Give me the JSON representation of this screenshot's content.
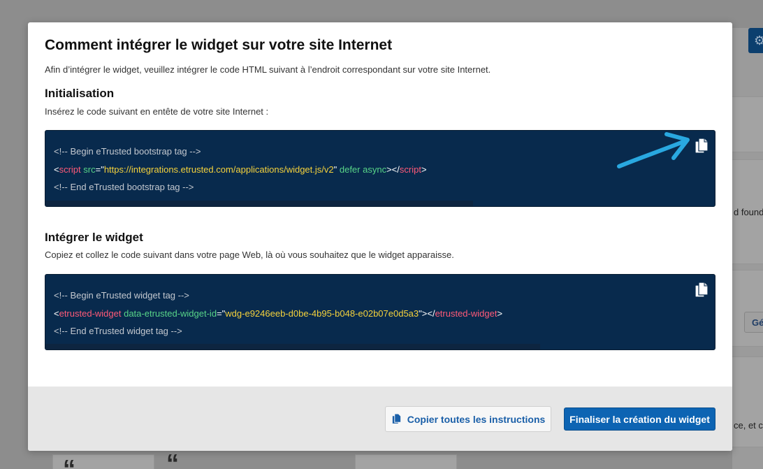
{
  "background": {
    "right_text_1": "d found",
    "right_text_2": "ce, et c",
    "right_button": "Gé",
    "quote_glyph": "“"
  },
  "modal": {
    "title": "Comment intégrer le widget sur votre site Internet",
    "intro": "Afin d’intégrer le widget, veuillez intégrer le code HTML suivant à l’endroit correspondant sur votre site Internet.",
    "sections": [
      {
        "title": "Initialisation",
        "description": "Insérez le code suivant en entête de votre site Internet :",
        "code": {
          "comment_begin": "<!-- Begin eTrusted bootstrap tag -->",
          "open_bracket": "<",
          "tag": "script",
          "attr_1": " src",
          "eq": "=",
          "quote": "\"",
          "value_1": "https://integrations.etrusted.com/applications/widget.js/v2",
          "attr_2": " defer async",
          "close_open": "></",
          "close_bracket": ">",
          "comment_end": "<!-- End eTrusted bootstrap tag -->"
        }
      },
      {
        "title": "Intégrer le widget",
        "description": "Copiez et collez le code suivant dans votre page Web, là où vous souhaitez que le widget apparaisse.",
        "code": {
          "comment_begin": "<!-- Begin eTrusted widget tag -->",
          "open_bracket": "<",
          "tag": "etrusted-widget",
          "attr_1": " data-etrusted-widget-id",
          "eq": "=",
          "quote": "\"",
          "value_1": "wdg-e9246eeb-d0be-4b95-b048-e02b07e0d5a3",
          "close_open": "></",
          "close_bracket": ">",
          "comment_end": "<!-- End eTrusted widget tag -->"
        }
      }
    ],
    "footer": {
      "copy_all_label": "Copier toutes les instructions",
      "finalize_label": "Finaliser la création du widget"
    }
  },
  "colors": {
    "code_bg": "#082a4d",
    "primary": "#0d64b3",
    "arrow": "#29a8e0"
  },
  "icons": [
    "copy-icon",
    "gear-icon",
    "arrow-annotation"
  ]
}
